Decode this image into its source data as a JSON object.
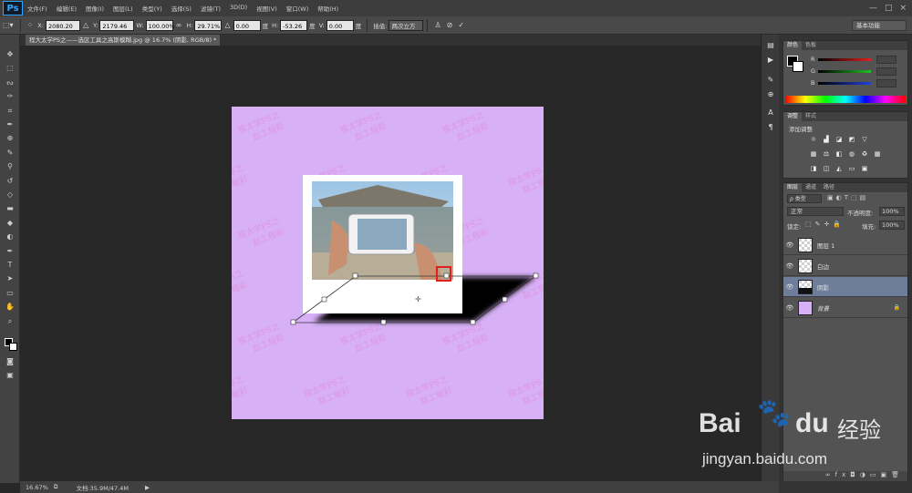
{
  "app": {
    "logo": "Ps"
  },
  "menu": [
    "文件(F)",
    "编辑(E)",
    "图像(I)",
    "图层(L)",
    "类型(Y)",
    "选择(S)",
    "滤镜(T)",
    "3D(D)",
    "视图(V)",
    "窗口(W)",
    "帮助(H)"
  ],
  "window_controls": [
    "—",
    "□",
    "×"
  ],
  "options": {
    "x_label": "X:",
    "x_value": "2080.20 像",
    "y_label": "Y:",
    "y_value": "2179.46 像",
    "w_label": "W:",
    "w_value": "100.00%",
    "h_label": "H:",
    "h_value": "29.71%",
    "angle_value": "0.00",
    "angle_unit": "度",
    "hskew_label": "H:",
    "hskew_value": "-53.26",
    "hskew_unit": "度",
    "vskew_label": "V:",
    "vskew_value": "0.00",
    "vskew_unit": "度",
    "interp_label": "插值:",
    "interp_value": "两次立方",
    "workspace": "基本功能"
  },
  "document_tab": "程大太学PS之——选区工具之高斯模糊.jpg @ 16.7% (阴影, RGB/8) *",
  "status": {
    "zoom": "16.67%",
    "doc_size": "文档:35.9M/47.4M"
  },
  "panels": {
    "color_tabs": [
      "颜色",
      "色板"
    ],
    "color_channels": [
      "R",
      "G",
      "B"
    ],
    "adjust_tabs": [
      "调整",
      "样式"
    ],
    "adjust_title": "添加调整",
    "layers_tabs": [
      "图层",
      "通道",
      "路径"
    ],
    "kind_filter": "ρ 类型",
    "blend_mode": "正常",
    "opacity_label": "不透明度:",
    "opacity_value": "100%",
    "lock_label": "锁定:",
    "fill_label": "填充:",
    "fill_value": "100%"
  },
  "layers": [
    {
      "name": "图层 1",
      "selected": false,
      "thumb": "checker"
    },
    {
      "name": "白边",
      "selected": false,
      "thumb": "checker"
    },
    {
      "name": "阴影",
      "selected": true,
      "thumb": "shadow"
    },
    {
      "name": "背景",
      "selected": false,
      "thumb": "#d7b0f6",
      "locked": true
    }
  ],
  "watermark": {
    "text": "程太学PS之",
    "text2": "赵工程彩"
  },
  "baidu": {
    "brand": "Bai",
    "brand2": "du",
    "cn": "经验",
    "url": "jingyan.baidu.com"
  },
  "colors": {
    "accent": "#31a8ff",
    "canvas_bg": "#d7b0f6",
    "selection": "#6d7d9a"
  }
}
